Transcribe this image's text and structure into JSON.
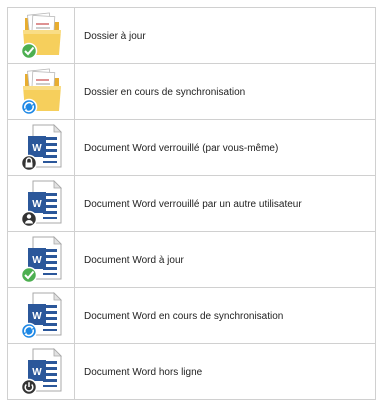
{
  "legend": {
    "rows": [
      {
        "label": "Dossier à jour",
        "icon": "folder-icon",
        "badge": "synced-check-icon",
        "badge_color": "#4caf50"
      },
      {
        "label": "Dossier en cours de synchronisation",
        "icon": "folder-icon",
        "badge": "syncing-arrows-icon",
        "badge_color": "#1e88e5"
      },
      {
        "label": "Document Word verrouillé (par vous-même)",
        "icon": "word-document-icon",
        "badge": "lock-icon",
        "badge_color": "#333333"
      },
      {
        "label": "Document Word verrouillé par un autre utilisateur",
        "icon": "word-document-icon",
        "badge": "user-lock-icon",
        "badge_color": "#333333"
      },
      {
        "label": "Document Word à jour",
        "icon": "word-document-icon",
        "badge": "synced-check-icon",
        "badge_color": "#4caf50"
      },
      {
        "label": "Document Word en cours de synchronisation",
        "icon": "word-document-icon",
        "badge": "syncing-arrows-icon",
        "badge_color": "#1e88e5"
      },
      {
        "label": "Document Word hors ligne",
        "icon": "word-document-icon",
        "badge": "offline-power-icon",
        "badge_color": "#333333"
      }
    ]
  },
  "colors": {
    "border": "#d0d0d0",
    "folder_yellow": "#f3c24d",
    "word_blue": "#2b579a"
  }
}
